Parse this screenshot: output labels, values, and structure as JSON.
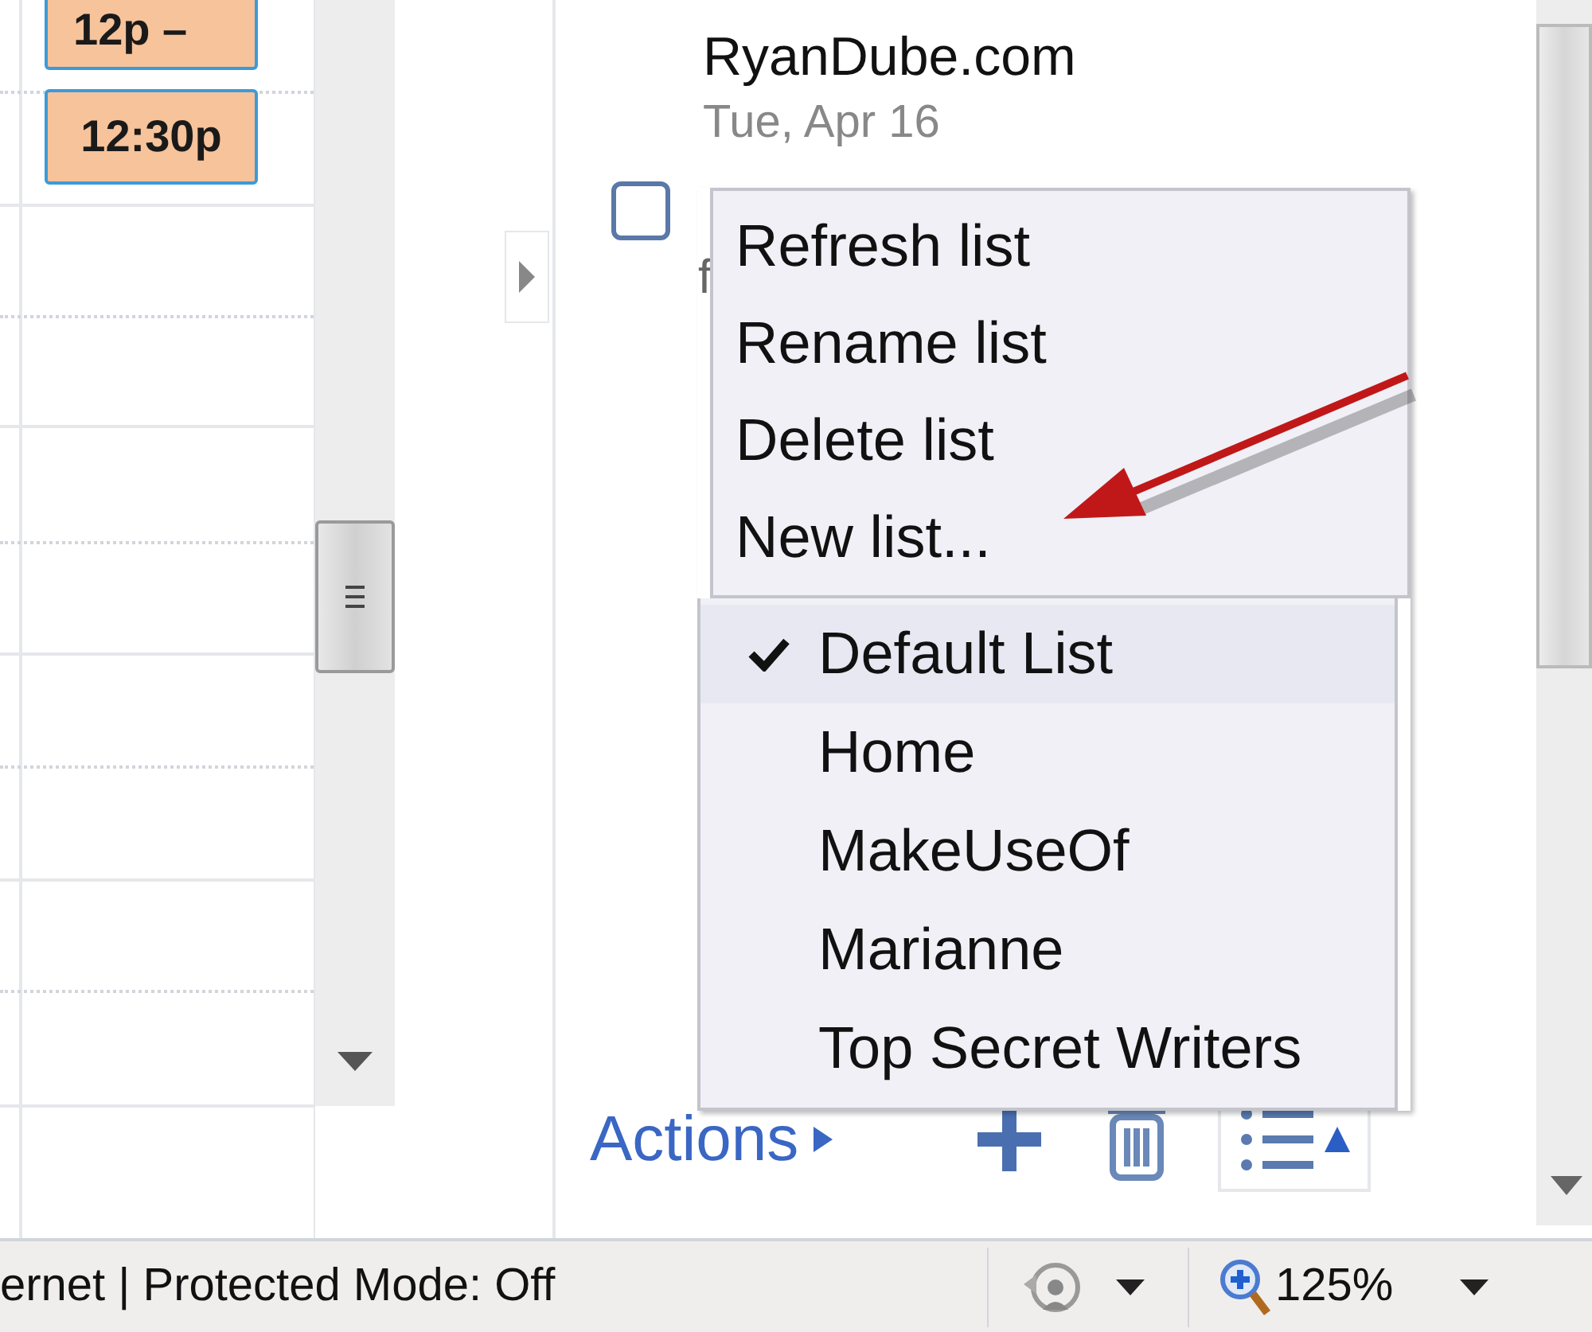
{
  "calendar": {
    "events": [
      {
        "label": "12p –"
      },
      {
        "label": "12:30p"
      }
    ]
  },
  "tasks": {
    "list_name": "RyanDube.com",
    "date": "Tue, Apr 16",
    "task": {
      "checked": false,
      "notes": "f"
    }
  },
  "menu": {
    "actions": [
      "Refresh list",
      "Rename list",
      "Delete list",
      "New list..."
    ],
    "lists": [
      {
        "label": "Default List",
        "selected": true
      },
      {
        "label": "Home",
        "selected": false
      },
      {
        "label": "MakeUseOf",
        "selected": false
      },
      {
        "label": "Marianne",
        "selected": false
      },
      {
        "label": "Top Secret Writers",
        "selected": false
      }
    ]
  },
  "toolbar": {
    "actions_label": "Actions"
  },
  "status_bar": {
    "text": "ernet | Protected Mode: Off",
    "zoom": "125%"
  }
}
